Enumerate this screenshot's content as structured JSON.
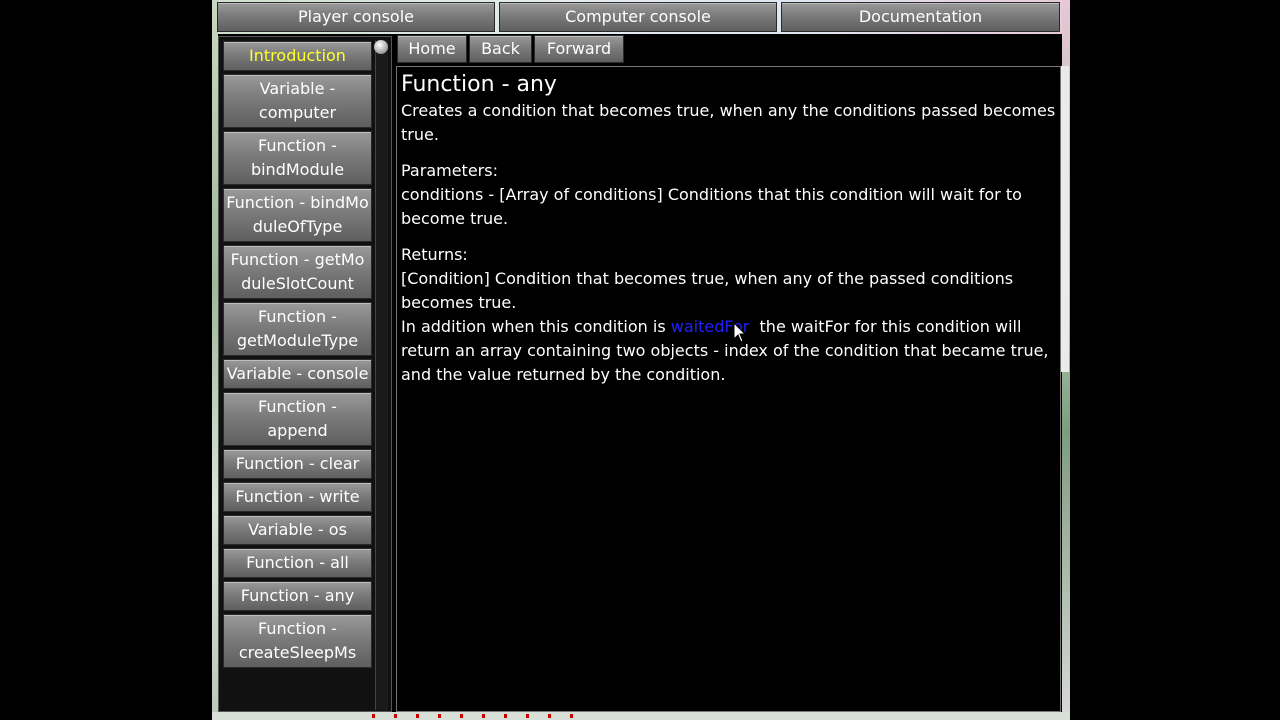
{
  "top_tabs": [
    "Player console",
    "Computer console",
    "Documentation"
  ],
  "nav_buttons": [
    "Home",
    "Back",
    "Forward"
  ],
  "sidebar": {
    "items": [
      {
        "label": "Introduction",
        "active": true
      },
      {
        "label": "Variable - computer"
      },
      {
        "label": "Function - bindModule"
      },
      {
        "label": "Function - bindModuleOfType"
      },
      {
        "label": "Function - getModuleSlotCount"
      },
      {
        "label": "Function - getModuleType"
      },
      {
        "label": "Variable - console"
      },
      {
        "label": "Function - append"
      },
      {
        "label": "Function - clear"
      },
      {
        "label": "Function - write"
      },
      {
        "label": "Variable - os"
      },
      {
        "label": "Function - all"
      },
      {
        "label": "Function - any"
      },
      {
        "label": "Function - createSleepMs"
      }
    ]
  },
  "doc": {
    "title": "Function - any",
    "description": "Creates a condition that becomes true, when any the conditions passed becomes true.",
    "parameters_heading": "Parameters:",
    "parameters_text": "conditions - [Array of conditions] Conditions that this condition will wait for to become true.",
    "returns_heading": "Returns:",
    "returns_text": "[Condition] Condition that becomes true, when any of the passed conditions becomes true.",
    "addition_before": "In addition when this condition is ",
    "addition_link": "waitedFor",
    "addition_after": "  the waitFor for this condition will return an array containing two objects - index of the condition that became true, and the value returned by the condition."
  },
  "colors": {
    "active_item": "#ffff33",
    "link": "#2020ff",
    "background": "#000000"
  }
}
